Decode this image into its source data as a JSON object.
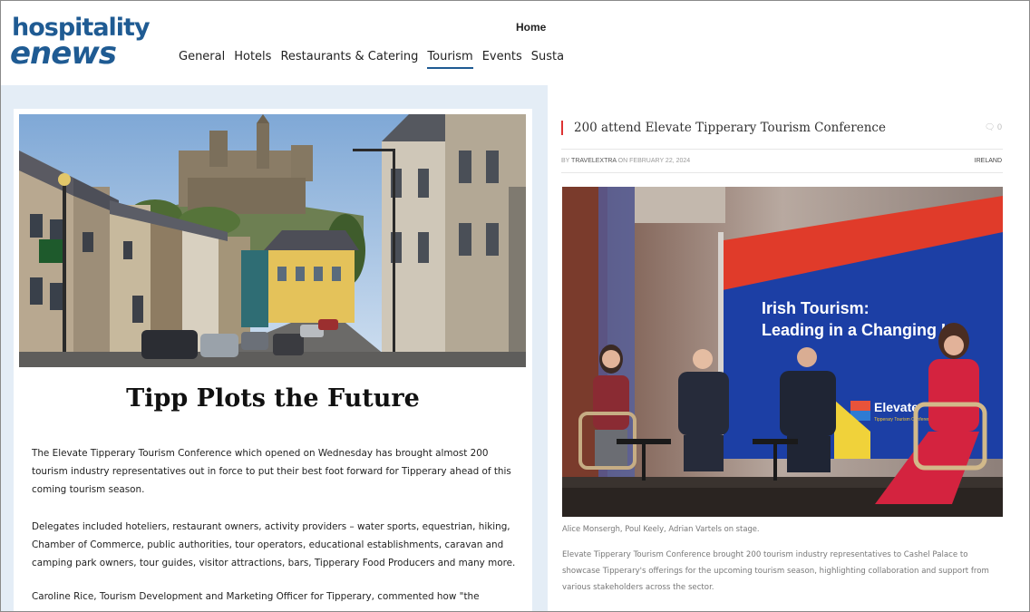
{
  "site": {
    "logo_line1": "hospitality",
    "logo_line2": "enews"
  },
  "header": {
    "home_label": "Home",
    "nav": [
      "General",
      "Hotels",
      "Restaurants & Catering",
      "Tourism",
      "Events",
      "Susta"
    ],
    "active_nav": "Tourism"
  },
  "left_article": {
    "headline": "Tipp Plots the Future",
    "paragraphs": [
      "The Elevate Tipperary Tourism Conference which opened on Wednesday has brought almost 200 tourism industry representatives out in force to put their best foot forward for Tipperary ahead of this coming tourism season.",
      "Delegates included hoteliers, restaurant owners, activity providers – water sports, equestrian, hiking, Chamber of Commerce, public authorities, tour operators, educational establishments, caravan and camping park owners, tour guides, visitor attractions, bars, Tipperary Food Producers and many more.",
      "Caroline Rice, Tourism Development and Marketing Officer for Tipperary, commented how \"the"
    ]
  },
  "right_article": {
    "title": "200 attend Elevate Tipperary Tourism Conference",
    "comments": "0",
    "meta_prefix": "BY",
    "author": "TRAVELEXTRA",
    "date_prefix": "ON",
    "date": "FEBRUARY 22, 2024",
    "category": "IRELAND",
    "screen_text_1": "Irish Tourism:",
    "screen_text_2": "Leading in a Changing La",
    "screen_logo": "Elevate",
    "screen_logo_sub": "Tipperary Tourism Conference",
    "caption": "Alice Monsergh, Poul Keely, Adrian Vartels on stage.",
    "description": "Elevate Tipperary Tourism Conference brought 200 tourism industry representatives to Cashel Palace to showcase Tipperary's offerings for the upcoming tourism season, highlighting collaboration and support from various stakeholders across the sector."
  },
  "colors": {
    "brand_blue": "#1f5b93",
    "panel_bg": "#e4edf6",
    "accent_red": "#dd3333"
  }
}
